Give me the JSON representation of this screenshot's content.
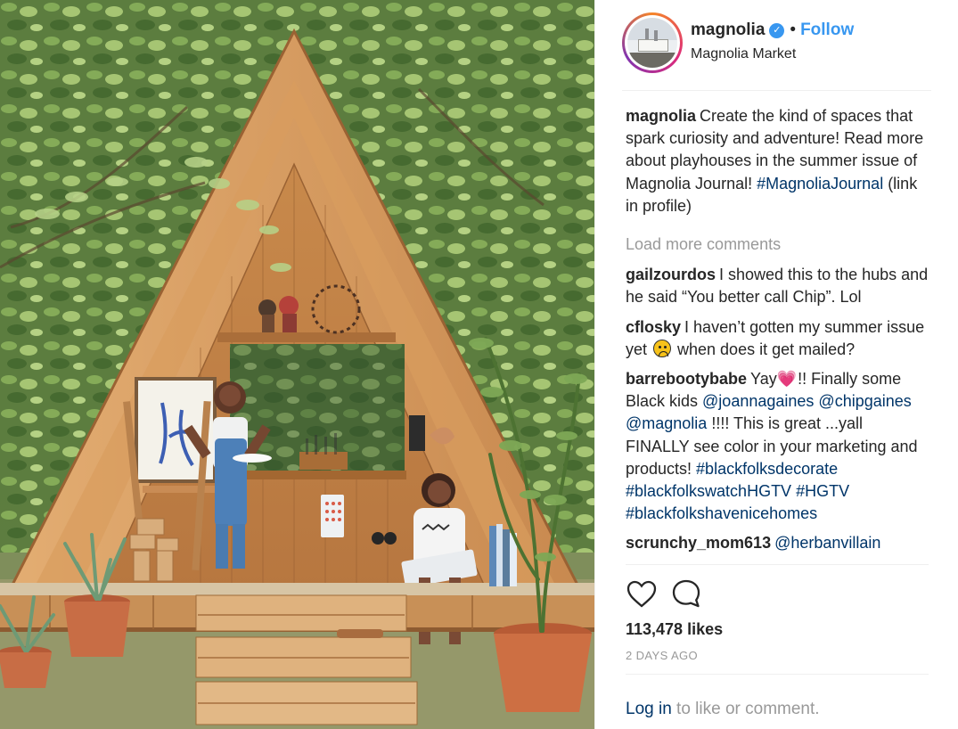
{
  "post": {
    "username": "magnolia",
    "verified_icon": "verified-check-icon",
    "separator": "•",
    "follow_label": "Follow",
    "location": "Magnolia Market",
    "avatar_text": "MAGNOLIA"
  },
  "caption": {
    "username": "magnolia",
    "text": "Create the kind of spaces that spark curiosity and adventure! Read more about playhouses in the summer issue of Magnolia Journal! ",
    "hashtag": "#MagnoliaJournal",
    "text_after": " (link in profile)"
  },
  "load_more": "Load more comments",
  "comments": [
    {
      "username": "gailzourdos",
      "text": "I showed this to the hubs and he said “You better call Chip”. Lol"
    },
    {
      "username": "cflosky",
      "text_before": "I haven’t gotten my summer issue yet ",
      "emoji": "frowning-face-emoji",
      "text_after": " when does it get mailed?"
    },
    {
      "username": "barrebootybabe",
      "text_before": "Yay",
      "emoji": "sparkling-heart-emoji",
      "text_mid": "!! Finally some Black kids ",
      "mention1": "@joannagaines",
      "mention2": "@chipgaines",
      "mention3": "@magnolia",
      "text_after": " !!!! This is great ...yall FINALLY see color in your marketing and products! ",
      "tag1": "#blackfolksdecorate",
      "tag2": "#blackfolkswatchHGTV",
      "tag3": "#HGTV",
      "tag4": "#blackfolkshavenicehomes"
    },
    {
      "username": "scrunchy_mom613",
      "mention": "@herbanvillain"
    }
  ],
  "actions": {
    "like_icon": "heart-outline-icon",
    "comment_icon": "comment-bubble-icon"
  },
  "likes": "113,478 likes",
  "time": "2 DAYS AGO",
  "login": {
    "link": "Log in",
    "text": " to like or comment."
  },
  "colors": {
    "link_blue": "#3897f0",
    "mention_navy": "#003569",
    "muted_gray": "#999999",
    "wood": "#d7a46b"
  }
}
